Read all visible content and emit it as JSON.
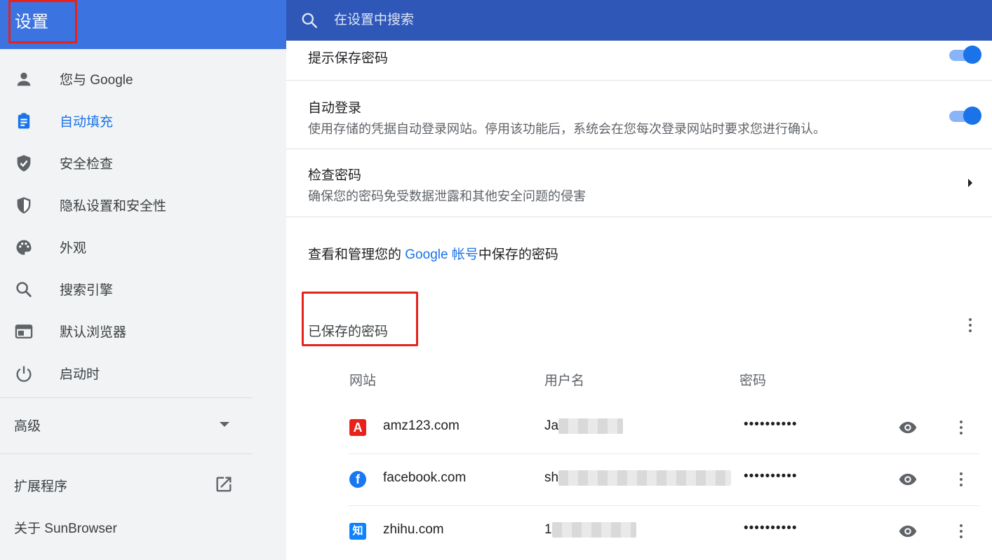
{
  "header": {
    "title": "设置",
    "search_placeholder": "在设置中搜索"
  },
  "sidebar": {
    "items": [
      {
        "label": "您与 Google",
        "icon": "person-icon"
      },
      {
        "label": "自动填充",
        "icon": "clipboard-icon",
        "active": true
      },
      {
        "label": "安全检查",
        "icon": "shield-check-icon"
      },
      {
        "label": "隐私设置和安全性",
        "icon": "shield-half-icon"
      },
      {
        "label": "外观",
        "icon": "palette-icon"
      },
      {
        "label": "搜索引擎",
        "icon": "search-icon"
      },
      {
        "label": "默认浏览器",
        "icon": "browser-icon"
      },
      {
        "label": "启动时",
        "icon": "power-icon"
      }
    ],
    "advanced": "高级",
    "extensions": "扩展程序",
    "about": "关于 SunBrowser"
  },
  "main": {
    "offer_save": {
      "label": "提示保存密码",
      "enabled": true
    },
    "auto_signin": {
      "label": "自动登录",
      "desc": "使用存储的凭据自动登录网站。停用该功能后，系统会在您每次登录网站时要求您进行确认。",
      "enabled": true
    },
    "check_passwords": {
      "label": "检查密码",
      "desc": "确保您的密码免受数据泄露和其他安全问题的侵害"
    },
    "manage": {
      "prefix": "查看和管理您的 ",
      "link": "Google 帐号",
      "suffix": "中保存的密码"
    },
    "saved_title": "已保存的密码",
    "columns": {
      "site": "网站",
      "username": "用户名",
      "password": "密码"
    },
    "rows": [
      {
        "site": "amz123.com",
        "username_visible": "Ja",
        "password": "••••••••••",
        "icon_text": "A",
        "icon_color": "#e8211b"
      },
      {
        "site": "facebook.com",
        "username_visible": "sh",
        "password": "••••••••••",
        "icon_text": "f",
        "icon_color": "#1877f2"
      },
      {
        "site": "zhihu.com",
        "username_visible": "1",
        "password": "••••••••••",
        "icon_text": "知",
        "icon_color": "#0e83ff"
      }
    ]
  },
  "colors": {
    "accent": "#1a73e8",
    "header": "#3367d6",
    "highlight": "#e8211b"
  }
}
